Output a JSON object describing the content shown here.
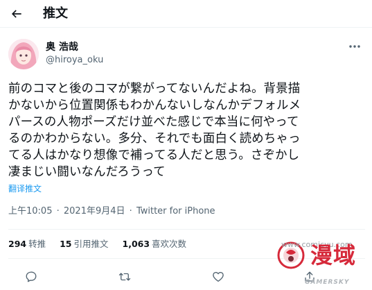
{
  "header": {
    "title": "推文",
    "back_icon": "arrow-left-icon"
  },
  "author": {
    "name": "奥 浩哉",
    "handle": "@hiroya_oku",
    "avatar_icon": "anime-avatar"
  },
  "tweet": {
    "lines": [
      "前のコマと後のコマが繋がってないんだよね。背景描",
      "かないから位置関係もわかんないしなんかデフォルメ",
      "パースの人物ポーズだけ並べた感じで本当に何やって",
      "るのかわからない。多分、それでも面白く読めちゃっ",
      "てる人はかなり想像で補ってる人だと思う。さぞかし",
      "凄まじい闘いなんだろうって"
    ],
    "translate_label": "翻译推文",
    "time": "上午10:05",
    "date": "2021年9月4日",
    "separator": "·",
    "source": "Twitter for iPhone"
  },
  "stats": {
    "retweets_count": "294",
    "retweets_label": "转推",
    "quotes_count": "15",
    "quotes_label": "引用推文",
    "likes_count": "1,063",
    "likes_label": "喜欢次数"
  },
  "actions": [
    "reply-icon",
    "retweet-icon",
    "like-icon",
    "share-icon"
  ],
  "watermark": {
    "url": "www.comicyu.com",
    "text": "漫域",
    "sub": "GAMERSKY"
  },
  "colors": {
    "text": "#0f1419",
    "secondary": "#536471",
    "link": "#1d9bf0",
    "divider": "#eff3f4",
    "watermark_red": "#d6293a"
  }
}
